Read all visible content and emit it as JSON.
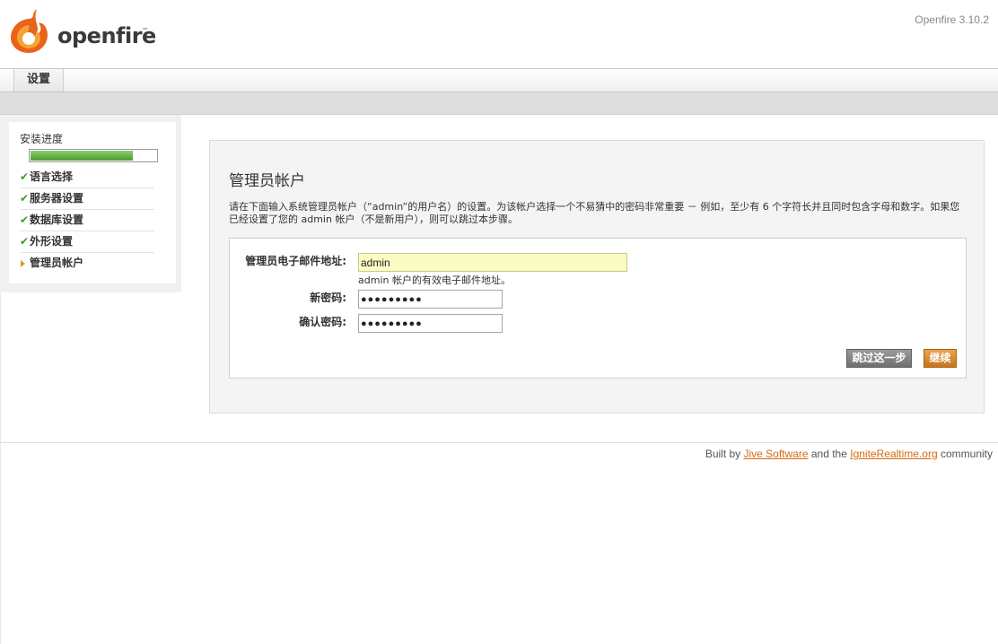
{
  "header": {
    "logo_text": "openfire",
    "logo_tm": "™",
    "version": "Openfire 3.10.2"
  },
  "nav": {
    "tabs": [
      {
        "label": "设置",
        "active": true
      }
    ]
  },
  "sidebar": {
    "progress_label": "安装进度",
    "progress_percent": 80,
    "steps": [
      {
        "label": "语言选择",
        "status": "done"
      },
      {
        "label": "服务器设置",
        "status": "done"
      },
      {
        "label": "数据库设置",
        "status": "done"
      },
      {
        "label": "外形设置",
        "status": "done"
      },
      {
        "label": "管理员帐户",
        "status": "current"
      }
    ],
    "done_mark": "✔"
  },
  "main": {
    "title": "管理员帐户",
    "description": "请在下面输入系统管理员帐户（“admin”的用户名）的设置。为该帐户选择一个不易猜中的密码非常重要 － 例如，至少有 6 个字符长并且同时包含字母和数字。如果您已经设置了您的 admin 帐户（不是新用户），则可以跳过本步骤。",
    "form": {
      "email_label": "管理员电子邮件地址:",
      "email_value": "admin",
      "email_hint": "admin 帐户的有效电子邮件地址。",
      "new_password_label": "新密码:",
      "new_password_value": "●●●●●●●●●",
      "confirm_password_label": "确认密码:",
      "confirm_password_value": "●●●●●●●●●"
    },
    "buttons": {
      "skip": "跳过这一步",
      "continue": "继续"
    }
  },
  "footer": {
    "prefix": "Built by ",
    "link1": "Jive Software",
    "middle": " and the ",
    "link2": "IgniteRealtime.org",
    "suffix": " community"
  },
  "colors": {
    "accent": "#e07b1f",
    "progress": "#5aa83a",
    "check": "#3f9a2a"
  }
}
